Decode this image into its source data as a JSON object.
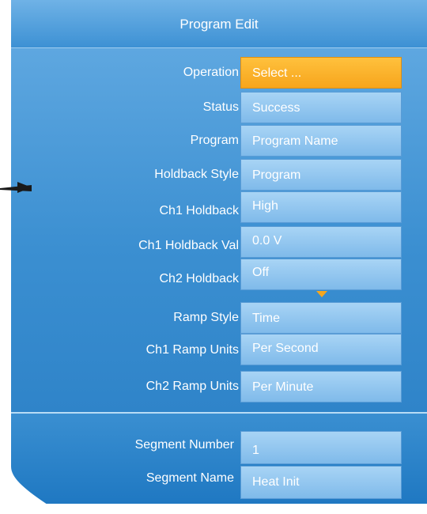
{
  "header": {
    "title": "Program Edit"
  },
  "fields": [
    {
      "label": "Operation",
      "value": "Select ..."
    },
    {
      "label": "Status",
      "value": "Success"
    },
    {
      "label": "Program",
      "value": "Program Name"
    },
    {
      "label": "Holdback Style",
      "value": "Program"
    },
    {
      "label": "Ch1 Holdback",
      "value": "High"
    },
    {
      "label": "Ch1 Holdback Val",
      "value": "0.0 V"
    },
    {
      "label": "Ch2 Holdback",
      "value": "Off"
    },
    {
      "label": "Ramp Style",
      "value": "Time"
    },
    {
      "label": "Ch1 Ramp Units",
      "value": "Per Second"
    },
    {
      "label": "Ch2 Ramp Units",
      "value": "Per Minute"
    }
  ],
  "segment": {
    "number_label": "Segment Number",
    "number_value": "1",
    "name_label": "Segment Name",
    "name_value": "Heat Init"
  },
  "colors": {
    "panel": "#2f86cc",
    "selected_field": "#f7a51c",
    "field": "#8fc5ee",
    "text": "#ffffff"
  }
}
